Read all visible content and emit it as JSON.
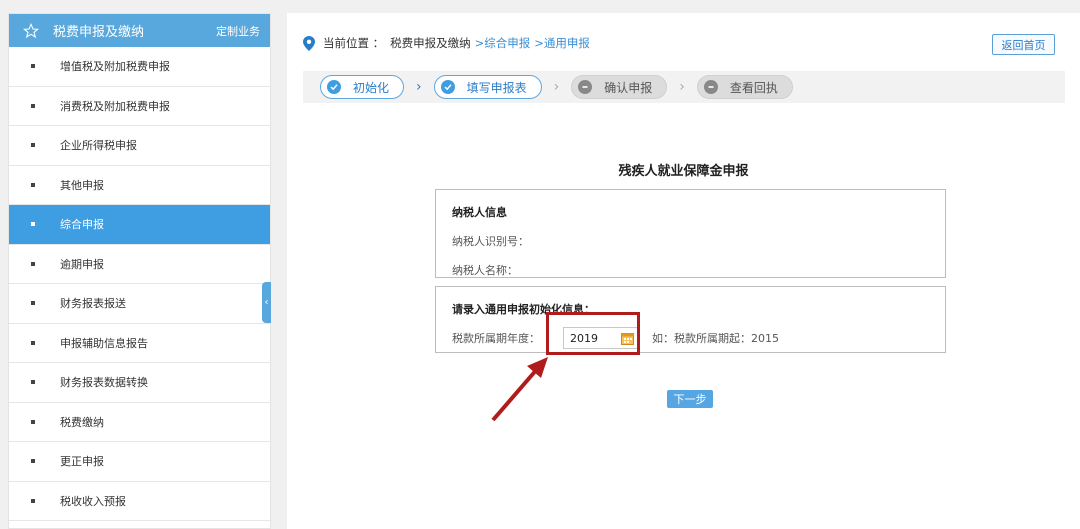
{
  "sidebar": {
    "title": "税费申报及缴纳",
    "custom_label": "定制业务",
    "items": [
      {
        "label": "增值税及附加税费申报"
      },
      {
        "label": "消费税及附加税费申报"
      },
      {
        "label": "企业所得税申报"
      },
      {
        "label": "其他申报"
      },
      {
        "label": "综合申报",
        "active": true
      },
      {
        "label": "逾期申报"
      },
      {
        "label": "财务报表报送"
      },
      {
        "label": "申报辅助信息报告"
      },
      {
        "label": "财务报表数据转换"
      },
      {
        "label": "税费缴纳"
      },
      {
        "label": "更正申报"
      },
      {
        "label": "税收收入预报"
      }
    ]
  },
  "breadcrumb": {
    "label": "当前位置 ：",
    "items": [
      "税费申报及缴纳",
      ">综合申报",
      ">通用申报"
    ]
  },
  "home_button": "返回首页",
  "steps": [
    {
      "label": "初始化",
      "status": "done"
    },
    {
      "label": "填写申报表",
      "status": "done"
    },
    {
      "label": "确认申报",
      "status": "todo"
    },
    {
      "label": "查看回执",
      "status": "todo"
    }
  ],
  "form": {
    "title": "残疾人就业保障金申报",
    "taxpayer_section": {
      "heading": "纳税人信息",
      "id_label": "纳税人识别号：",
      "name_label": "纳税人名称："
    },
    "init_section": {
      "heading": "请录入通用申报初始化信息：",
      "year_label": "税款所属期年度：",
      "year_value": "2019",
      "hint": "如：税款所属期起：2015"
    },
    "next_button": "下一步"
  },
  "colors": {
    "accent": "#3f9de2",
    "highlight": "#b01c1c"
  }
}
